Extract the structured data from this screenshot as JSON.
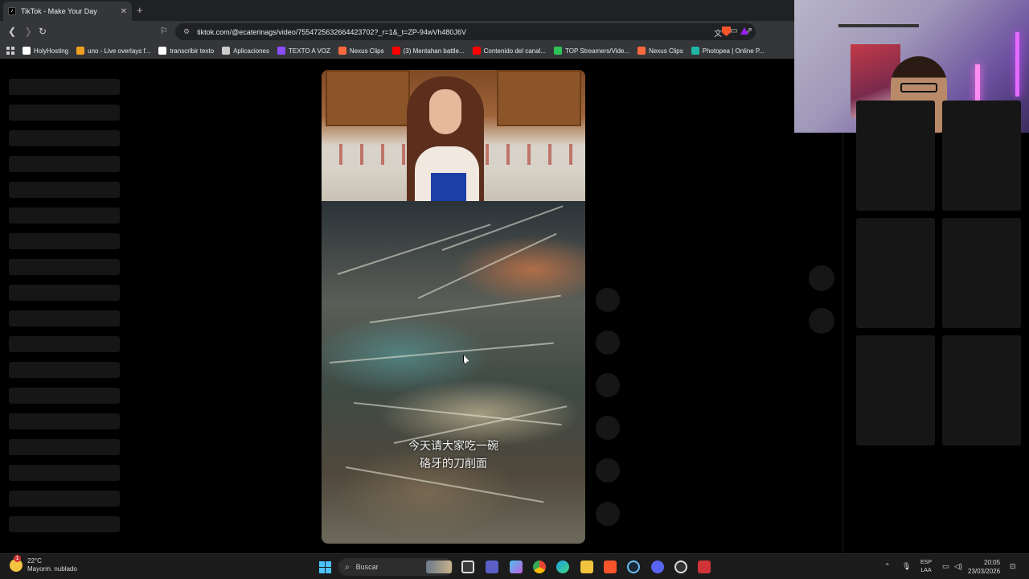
{
  "browser": {
    "tab_title": "TikTok - Make Your Day",
    "tab_favicon": "tiktok-icon",
    "url": "tiktok.com/@ecaterinags/video/7554725632664423702?_r=1&_t=ZP-94wVh480J6V",
    "bookmarks": [
      {
        "label": "HolyHosting",
        "color": "#ffffff"
      },
      {
        "label": "uno - Live overlays f...",
        "color": "#f0a020"
      },
      {
        "label": "transcribir texto",
        "color": "#ffffff"
      },
      {
        "label": "Aplicaciones",
        "color": "#cccccc"
      },
      {
        "label": "TEXTO A VOZ",
        "color": "#8a4dff"
      },
      {
        "label": "Nexus Clips",
        "color": "#ff6a3d"
      },
      {
        "label": "(3) Mentahan battle...",
        "color": "#ff0000"
      },
      {
        "label": "Contenido del canal...",
        "color": "#ff0000"
      },
      {
        "label": "TOP Streamers/Vide...",
        "color": "#2ec45a"
      },
      {
        "label": "Nexus Clips",
        "color": "#ff6a3d"
      },
      {
        "label": "Photopea | Online P...",
        "color": "#1fb7a4"
      }
    ]
  },
  "video": {
    "subtitle_line1": "今天请大家吃一碗",
    "subtitle_line2": "硌牙的刀削面"
  },
  "taskbar": {
    "weather_temp": "22°C",
    "weather_desc": "Mayorm. nublado",
    "weather_badge": "1",
    "search_placeholder": "Buscar",
    "lang_line1": "ESP",
    "lang_line2": "LAA",
    "time": "20:05",
    "date": "23/03/2026"
  }
}
